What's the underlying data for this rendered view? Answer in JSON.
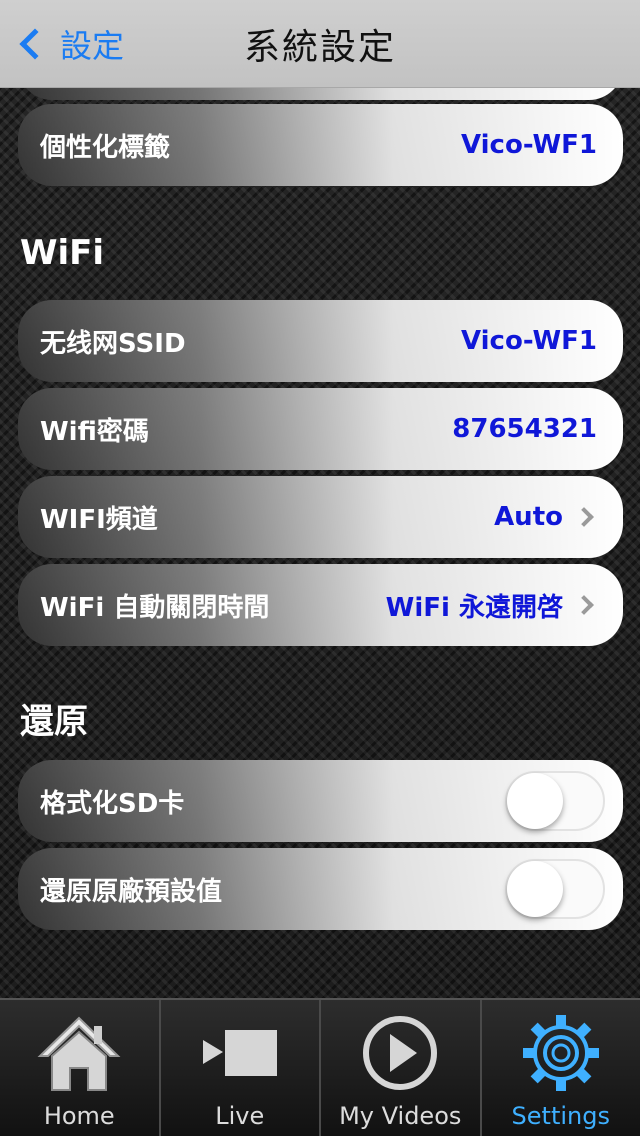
{
  "navbar": {
    "back_label": "設定",
    "title": "系統設定"
  },
  "rows_top": [
    {
      "label": "個性化標籤",
      "value": "Vico-WF1"
    }
  ],
  "wifi_section": {
    "header": "WiFi",
    "rows": [
      {
        "label": "无线网SSID",
        "value": "Vico-WF1"
      },
      {
        "label": "Wifi密碼",
        "value": "87654321"
      },
      {
        "label": "WIFI頻道",
        "value": "Auto"
      },
      {
        "label": "WiFi 自動關閉時間",
        "value": "WiFi 永遠開啓"
      }
    ]
  },
  "restore_section": {
    "header": "還原",
    "rows": [
      {
        "label": "格式化SD卡",
        "toggle_on": false
      },
      {
        "label": "還原原廠預設值",
        "toggle_on": false
      }
    ]
  },
  "tabbar": {
    "tabs": [
      {
        "label": "Home",
        "icon": "home-icon",
        "active": false
      },
      {
        "label": "Live",
        "icon": "video-camera-icon",
        "active": false
      },
      {
        "label": "My Videos",
        "icon": "play-icon",
        "active": false
      },
      {
        "label": "Settings",
        "icon": "gear-icon",
        "active": true
      }
    ]
  },
  "colors": {
    "accent": "#1b7cf2",
    "value_text": "#0f17d8",
    "active_tab": "#3fb0ff"
  }
}
